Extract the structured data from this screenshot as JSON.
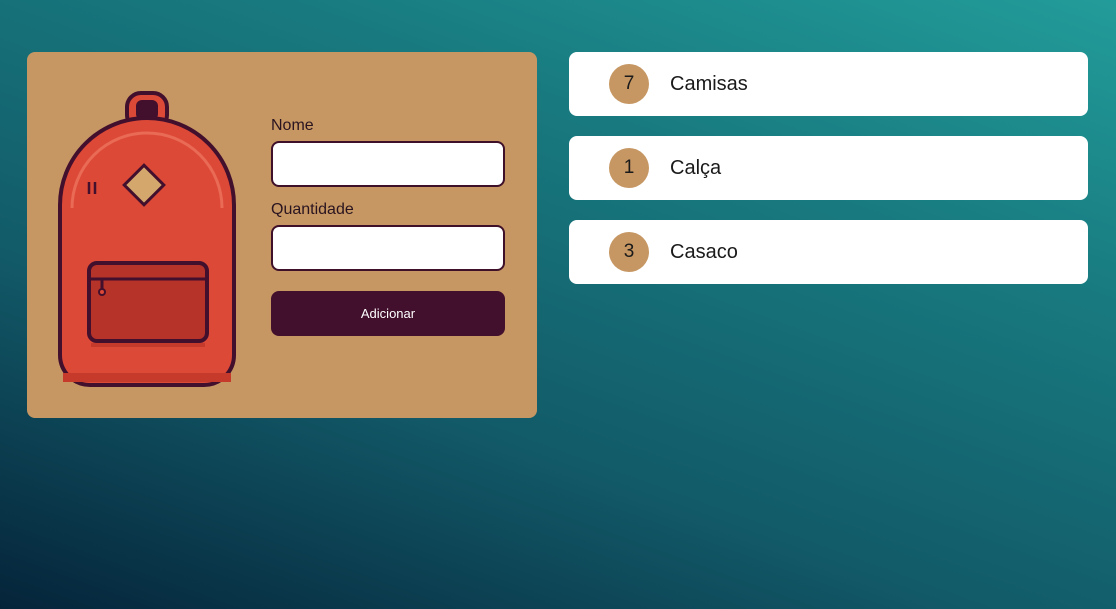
{
  "form": {
    "name_label": "Nome",
    "name_value": "",
    "quantity_label": "Quantidade",
    "quantity_value": "",
    "submit_label": "Adicionar"
  },
  "items": [
    {
      "quantity": "7",
      "name": "Camisas"
    },
    {
      "quantity": "1",
      "name": "Calça"
    },
    {
      "quantity": "3",
      "name": "Casaco"
    }
  ],
  "colors": {
    "card": "#c69763",
    "button": "#420f2d",
    "input_border": "#3f1029",
    "backpack_body": "#dc4937",
    "backpack_outline": "#420f2d",
    "item_background": "#ffffff"
  },
  "icons": {
    "illustration": "backpack-illustration"
  }
}
